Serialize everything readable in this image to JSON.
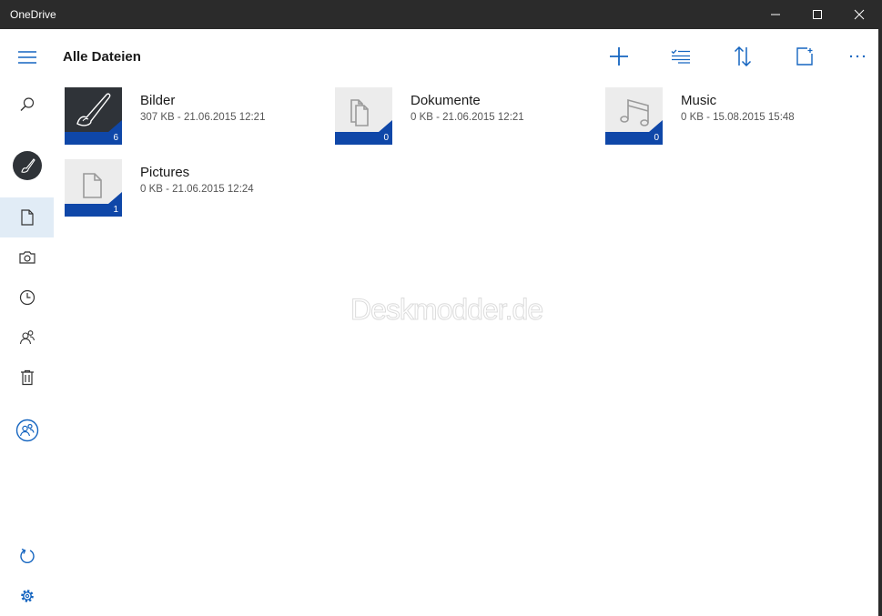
{
  "window": {
    "title": "OneDrive"
  },
  "header": {
    "title": "Alle Dateien"
  },
  "colors": {
    "accent": "#0f47a8",
    "titlebar": "#2b2b2b",
    "active_nav": "#e1ecf6"
  },
  "sidebar": {
    "items": [
      {
        "id": "menu",
        "icon": "hamburger-icon"
      },
      {
        "id": "search",
        "icon": "search-icon"
      },
      {
        "id": "account",
        "icon": "brush-avatar-icon"
      },
      {
        "id": "files",
        "icon": "document-icon",
        "active": true
      },
      {
        "id": "photos",
        "icon": "camera-icon"
      },
      {
        "id": "recent",
        "icon": "clock-icon"
      },
      {
        "id": "shared",
        "icon": "people-icon"
      },
      {
        "id": "recycle",
        "icon": "trash-icon"
      },
      {
        "id": "switch-account",
        "icon": "account-circle-icon"
      },
      {
        "id": "sync",
        "icon": "refresh-icon"
      },
      {
        "id": "settings",
        "icon": "gear-icon"
      }
    ]
  },
  "toolbar": {
    "items": [
      {
        "id": "add",
        "icon": "plus-icon"
      },
      {
        "id": "select",
        "icon": "select-list-icon"
      },
      {
        "id": "sort",
        "icon": "sort-icon"
      },
      {
        "id": "view",
        "icon": "view-mode-icon"
      },
      {
        "id": "more",
        "icon": "more-icon"
      }
    ]
  },
  "folders": [
    {
      "name": "Bilder",
      "meta": "307 KB - 21.06.2015 12:21",
      "count": "6",
      "icon": "pen-thumbnail"
    },
    {
      "name": "Dokumente",
      "meta": "0 KB - 21.06.2015 12:21",
      "count": "0",
      "icon": "documents-icon"
    },
    {
      "name": "Music",
      "meta": "0 KB - 15.08.2015 15:48",
      "count": "0",
      "icon": "music-note-icon"
    },
    {
      "name": "Pictures",
      "meta": "0 KB - 21.06.2015 12:24",
      "count": "1",
      "icon": "file-icon"
    }
  ],
  "watermark": "Deskmodder.de"
}
